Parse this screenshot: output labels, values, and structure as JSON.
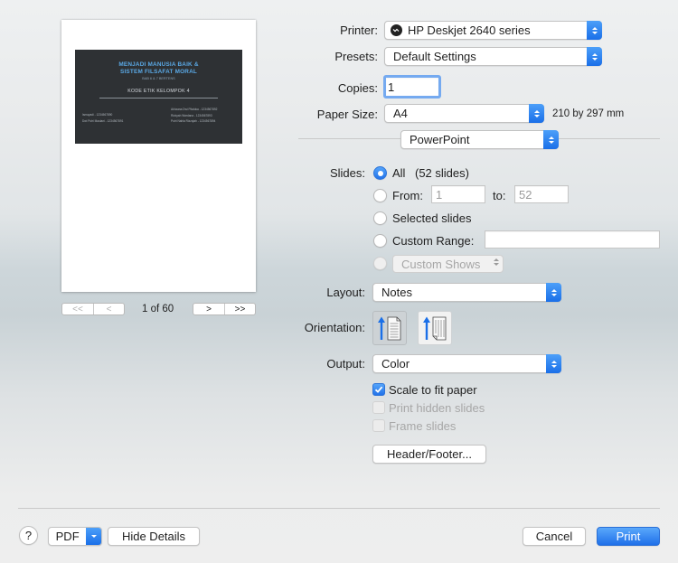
{
  "preview": {
    "slide": {
      "title_line1": "MENJADI MANUSIA BAIK &",
      "title_line2": "SISTEM FILSAFAT MORAL",
      "subtitle": "BAB 6 & 7 BERTENS",
      "group": "KODE ETIK KELOMPOK 4",
      "names_left": [
        "Ismayadi - 1234567890",
        "Dwi Putri Maulani - 1234567891"
      ],
      "names_right": [
        "Akhzana Dwi Pitaloka - 1234567892",
        "Rizkyah Wardana - 1234567893",
        "Putri Nahla Rizzqiah - 1234567894"
      ]
    },
    "first_label": "<<",
    "prev_label": "<",
    "next_label": ">",
    "last_label": ">>",
    "page_count": "1 of 60"
  },
  "printer": {
    "label": "Printer:",
    "value": "HP Deskjet 2640 series"
  },
  "presets": {
    "label": "Presets:",
    "value": "Default Settings"
  },
  "copies": {
    "label": "Copies:",
    "value": "1"
  },
  "paper_size": {
    "label": "Paper Size:",
    "value": "A4",
    "dimensions": "210 by 297 mm"
  },
  "section": {
    "value": "PowerPoint"
  },
  "slides": {
    "label": "Slides:",
    "all_label": "All",
    "all_count": "(52 slides)",
    "from_label": "From:",
    "from_value": "1",
    "to_label": "to:",
    "to_value": "52",
    "selected_label": "Selected slides",
    "custom_range_label": "Custom Range:",
    "custom_range_value": "",
    "custom_shows_label": "Custom Shows"
  },
  "layout": {
    "label": "Layout:",
    "value": "Notes"
  },
  "orientation": {
    "label": "Orientation:",
    "selected": "portrait"
  },
  "output": {
    "label": "Output:",
    "value": "Color"
  },
  "options": {
    "scale_to_fit": "Scale to fit paper",
    "print_hidden": "Print hidden slides",
    "frame_slides": "Frame slides"
  },
  "header_footer_label": "Header/Footer...",
  "footer": {
    "help_label": "?",
    "pdf_label": "PDF",
    "hide_details_label": "Hide Details",
    "cancel_label": "Cancel",
    "print_label": "Print"
  },
  "colors": {
    "accent": "#2373ea",
    "slide_bg": "#2e3134",
    "slide_title": "#5aa9e6"
  }
}
